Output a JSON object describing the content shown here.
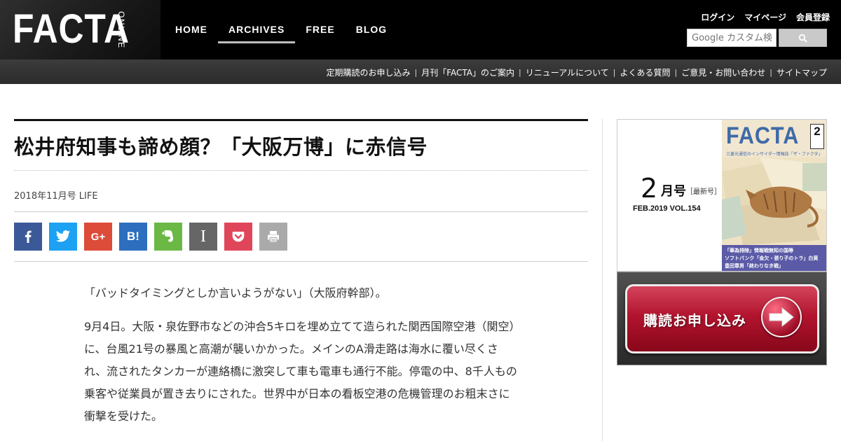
{
  "header": {
    "logo": "FACTA",
    "logo_sub": "ONLINE",
    "nav": [
      {
        "label": "HOME"
      },
      {
        "label": "ARCHIVES"
      },
      {
        "label": "FREE"
      },
      {
        "label": "BLOG"
      }
    ],
    "active_nav": "ARCHIVES",
    "user_links": {
      "login": "ログイン",
      "mypage": "マイページ",
      "register": "会員登録"
    },
    "search": {
      "placeholder": "Google カスタム検索",
      "button_icon": "search-icon"
    }
  },
  "subnav": {
    "links": [
      "定期購読のお申し込み",
      "月刊「FACTA」のご案内",
      "リニューアルについて",
      "よくある質問",
      "ご意見・お問い合わせ",
      "サイトマップ"
    ],
    "separator": "|"
  },
  "article": {
    "title": "松井府知事も諦め顔？「大阪万博」に赤信号",
    "meta": "2018年11月号 LIFE",
    "share_buttons": [
      {
        "name": "facebook",
        "glyph": "f",
        "color": "#3b5998"
      },
      {
        "name": "twitter",
        "glyph": "t",
        "color": "#1da1f2"
      },
      {
        "name": "google-plus",
        "glyph": "G+",
        "color": "#dd4b39"
      },
      {
        "name": "hatena",
        "glyph": "B!",
        "color": "#2d6fbe"
      },
      {
        "name": "evernote",
        "glyph": "e",
        "color": "#6bb845"
      },
      {
        "name": "instapaper",
        "glyph": "I",
        "color": "#666666"
      },
      {
        "name": "pocket",
        "glyph": "p",
        "color": "#e0465a"
      },
      {
        "name": "print",
        "glyph": "print",
        "color": "#aaaaaa"
      }
    ],
    "paragraphs": [
      "「バッドタイミングとしか言いようがない」（大阪府幹部）。",
      "9月4日。大阪・泉佐野市などの沖合5キロを埋め立てて造られた関西国際空港（関空）に、台風21号の暴風と高潮が襲いかかった。メインのA滑走路は海水に覆い尽くされ、流されたタンカーが連絡橋に激突して車も電車も通行不能。停電の中、8千人もの乗客や従業員が置き去りにされた。世界中が日本の看板空港の危機管理のお粗末さに衝撃を受けた。"
    ]
  },
  "sidebar": {
    "issue": {
      "month_number": "2",
      "month_unit": "月号",
      "latest": "［最新号］",
      "vol": "FEB.2019  VOL.154",
      "cover": {
        "logo": "FACTA",
        "badge": "2",
        "tagline": "三菱光通信のインサイダー情報誌「ザ・ファクタ」",
        "lines": [
          "「華為排除」情報戦無知の国辱",
          "ソフトバンク「金欠・張り子のトラ」白黄",
          "豊田章男「終わりなき戦」"
        ]
      }
    },
    "subscribe_label": "購読お申し込み"
  }
}
